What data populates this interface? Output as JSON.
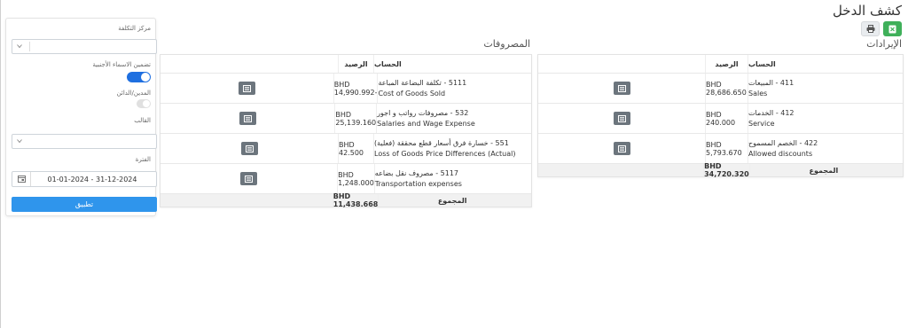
{
  "page": {
    "title": "كشف الدخل"
  },
  "toolbar": {
    "excel_icon": "excel-export-icon",
    "print_icon": "print-icon"
  },
  "revenues": {
    "section_title": "الإيرادات",
    "headers": {
      "account": "الحساب",
      "balance": "الرصيد"
    },
    "rows": [
      {
        "account_ar": "411 - المبيعات",
        "account_en": "Sales",
        "balance": "BHD 28,686.650"
      },
      {
        "account_ar": "412 - الخدمات",
        "account_en": "Service",
        "balance": "BHD 240.000"
      },
      {
        "account_ar": "422 - الخصم المسموح",
        "account_en": "Allowed discounts",
        "balance": "BHD 5,793.670"
      }
    ],
    "total_label": "المجموع",
    "total_value": "BHD 34,720.320"
  },
  "expenses": {
    "section_title": "المصروفات",
    "headers": {
      "account": "الحساب",
      "balance": "الرصيد"
    },
    "rows": [
      {
        "account_ar": "5111 - تكلفة البضاعة المباعة",
        "account_en": "Cost of Goods Sold",
        "balance": "BHD 14,990.992-"
      },
      {
        "account_ar": "532 - مصروفات رواتب و اجور",
        "account_en": "Salaries and Wage Expense",
        "balance": "BHD 25,139.160"
      },
      {
        "account_ar": "551 - خسارة فرق أسعار قطع محققة (فعلية)",
        "account_en": "Loss of Goods Price Differences (Actual)",
        "balance": "BHD 42.500"
      },
      {
        "account_ar": "5117 - مصروف نقل بضاعه",
        "account_en": "Transportation expenses",
        "balance": "BHD 1,248.000"
      }
    ],
    "total_label": "المجموع",
    "total_value": "BHD 11,438.668"
  },
  "filters": {
    "cost_center_label": "مركز التكلفة",
    "cost_center_value": "",
    "foreign_names_label": "تضمين الاسماء الأجنبية",
    "foreign_names_on": true,
    "debit_credit_label": "المدين/الدائن",
    "debit_credit_on": false,
    "template_label": "القالب",
    "template_value": "",
    "period_label": "الفترة",
    "period_value": "01-01-2024 - 31-12-2024",
    "apply_label": "تطبيق"
  },
  "colors": {
    "accent": "#2f95ec",
    "toggle_on": "#1e6fe0",
    "excel": "#3fb05a",
    "action_button": "#6c757d"
  }
}
